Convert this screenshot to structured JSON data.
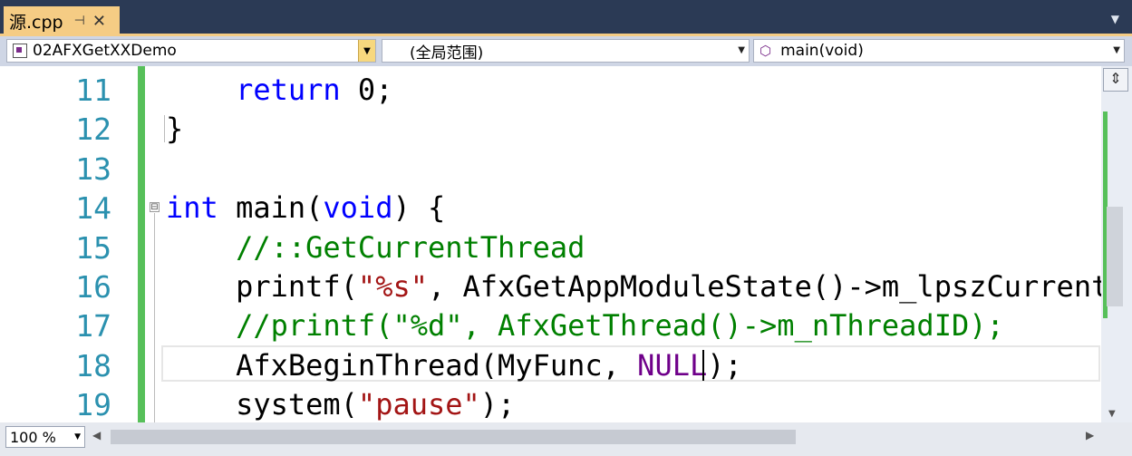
{
  "tab": {
    "title": "源.cpp",
    "pin": "⊣",
    "close": "✕",
    "menu": "▼"
  },
  "navbar": {
    "project": "02AFXGetXXDemo",
    "scope": "(全局范围)",
    "function": "main(void)"
  },
  "editor": {
    "line_numbers": [
      "11",
      "12",
      "13",
      "14",
      "15",
      "16",
      "17",
      "18",
      "19"
    ],
    "fold_marker": "⊟",
    "accent_color": "#57c05a",
    "current_line": "18"
  },
  "code": {
    "l11_return": "return",
    "l11_rest": " 0;",
    "l12": "}",
    "l14_int": "int",
    "l14_mid": " main(",
    "l14_void": "void",
    "l14_end": ") {",
    "l15_comment": "//::GetCurrentThread",
    "l16_a": "printf(",
    "l16_str": "\"%s\"",
    "l16_b": ", AfxGetAppModuleState()->m_lpszCurrentAppN",
    "l17_comment": "//printf(\"%d\", AfxGetThread()->m_nThreadID);",
    "l18_a": "AfxBeginThread(MyFunc, ",
    "l18_null": "NULL",
    "l18_b": ");",
    "l19_a": "system(",
    "l19_str": "\"pause\"",
    "l19_b": ");"
  },
  "status": {
    "zoom": "100 %"
  }
}
